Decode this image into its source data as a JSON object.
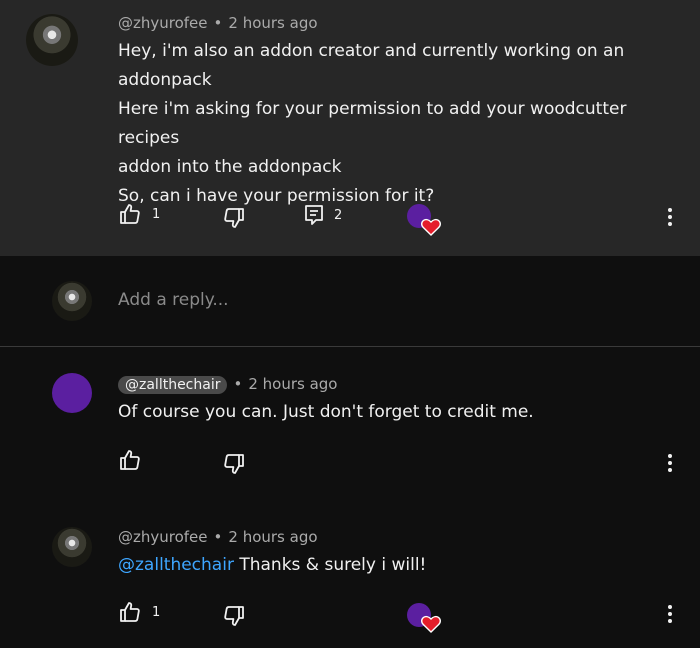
{
  "comments": [
    {
      "author": "@zhyurofee",
      "time": "2 hours ago",
      "lines": [
        "Hey, i'm also an addon creator and currently working on an",
        "addonpack",
        "Here i'm asking for your permission to add your woodcutter recipes",
        "addon into the addonpack",
        "So, can i have your permission for it?"
      ],
      "likes": "1",
      "replies": "2"
    },
    {
      "author": "@zallthechair",
      "time": "2 hours ago",
      "text": "Of course you can. Just don't forget to credit me."
    },
    {
      "author": "@zhyurofee",
      "time": "2 hours ago",
      "mention": "@zallthechair",
      "text": " Thanks & surely i will!",
      "likes": "1"
    }
  ],
  "reply_placeholder": "Add a reply...",
  "meta_separator": "•",
  "colors": {
    "top_background": "#272727",
    "page_background": "#0f0f0f",
    "heart": "#e51d2a",
    "mention": "#3ea6ff",
    "creator_avatar": "#5b1fa0"
  }
}
